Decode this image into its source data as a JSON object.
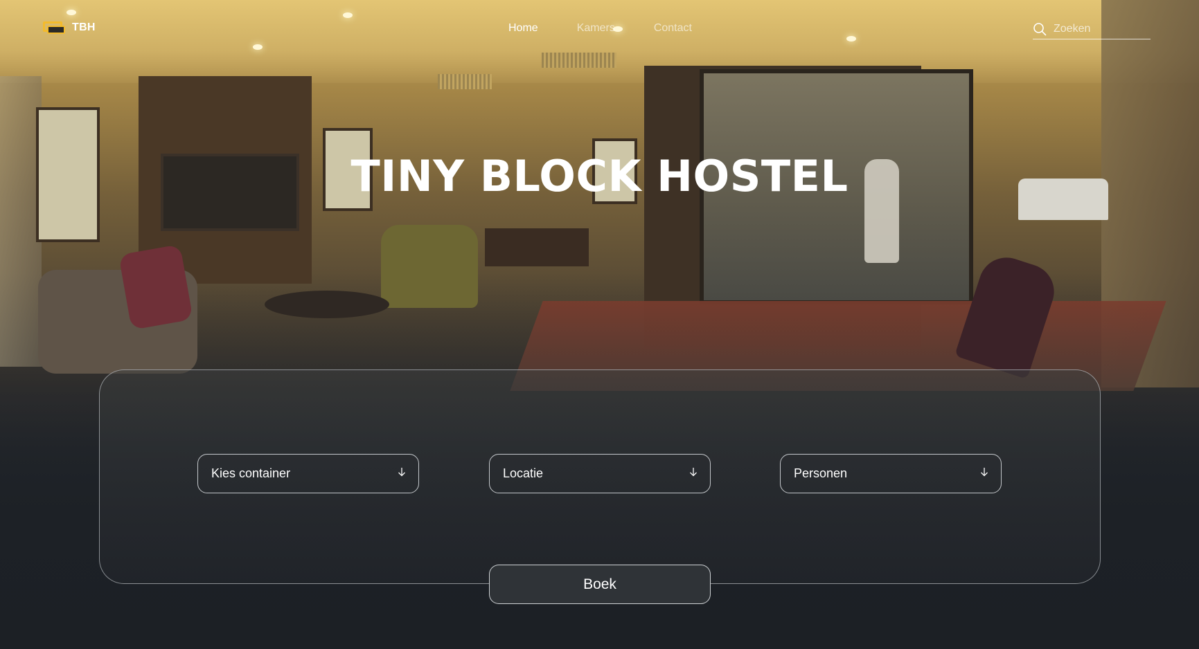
{
  "header": {
    "logo_text": "TBH",
    "nav": [
      {
        "label": "Home",
        "active": true
      },
      {
        "label": "Kamers",
        "active": false
      },
      {
        "label": "Contact",
        "active": false
      }
    ],
    "search": {
      "placeholder": "Zoeken",
      "icon": "search-icon"
    }
  },
  "hero": {
    "title": "TINY BLOCK HOSTEL"
  },
  "booking": {
    "selects": [
      {
        "label": "Kies container",
        "icon": "arrow-down-icon"
      },
      {
        "label": "Locatie",
        "icon": "arrow-down-icon"
      },
      {
        "label": "Personen",
        "icon": "arrow-down-icon"
      }
    ],
    "book_label": "Boek"
  },
  "colors": {
    "brand_accent": "#f3bb2c",
    "background_dark": "#1c2025",
    "button_fill": "#2f3337"
  }
}
